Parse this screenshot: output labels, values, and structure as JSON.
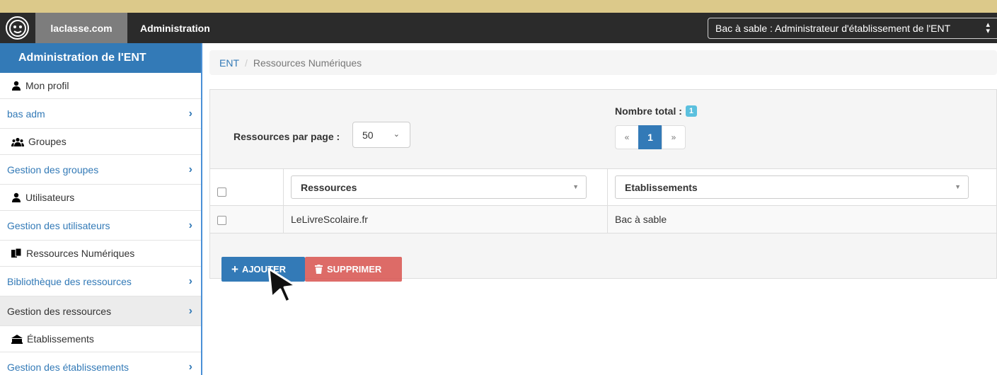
{
  "navbar": {
    "brand": "laclasse.com",
    "section": "Administration",
    "profile": "Bac à sable : Administrateur d'établissement de l'ENT"
  },
  "sidebar": {
    "header": "Administration de l'ENT",
    "items": [
      {
        "label": "Mon profil",
        "icon": "user-icon",
        "type": "sub"
      },
      {
        "label": "bas adm",
        "type": "link"
      },
      {
        "label": "Groupes",
        "icon": "group-icon",
        "type": "sub"
      },
      {
        "label": "Gestion des groupes",
        "type": "link"
      },
      {
        "label": "Utilisateurs",
        "icon": "user-icon",
        "type": "sub"
      },
      {
        "label": "Gestion des utilisateurs",
        "type": "link"
      },
      {
        "label": "Ressources Numériques",
        "icon": "files-icon",
        "type": "sub"
      },
      {
        "label": "Bibliothèque des ressources",
        "type": "link"
      },
      {
        "label": "Gestion des ressources",
        "type": "link",
        "active": true
      },
      {
        "label": "Établissements",
        "icon": "building-icon",
        "type": "sub"
      },
      {
        "label": "Gestion des établissements",
        "type": "link"
      }
    ]
  },
  "breadcrumb": {
    "root": "ENT",
    "current": "Ressources Numériques"
  },
  "controls": {
    "per_page_label": "Ressources par page :",
    "per_page_value": "50",
    "total_label": "Nombre total :",
    "total_value": "1",
    "pagination": [
      "«",
      "1",
      "»"
    ]
  },
  "table": {
    "columns": [
      "Ressources",
      "Etablissements"
    ],
    "rows": [
      {
        "ressource": "LeLivreScolaire.fr",
        "etablissement": "Bac à sable"
      }
    ]
  },
  "actions": {
    "add": "AJOUTER",
    "delete": "SUPPRIMER"
  },
  "colors": {
    "primary": "#337ab7",
    "danger": "#d9534f",
    "info": "#5bc0de",
    "navbar": "#2b2b2b",
    "background": "#dcc98a"
  }
}
